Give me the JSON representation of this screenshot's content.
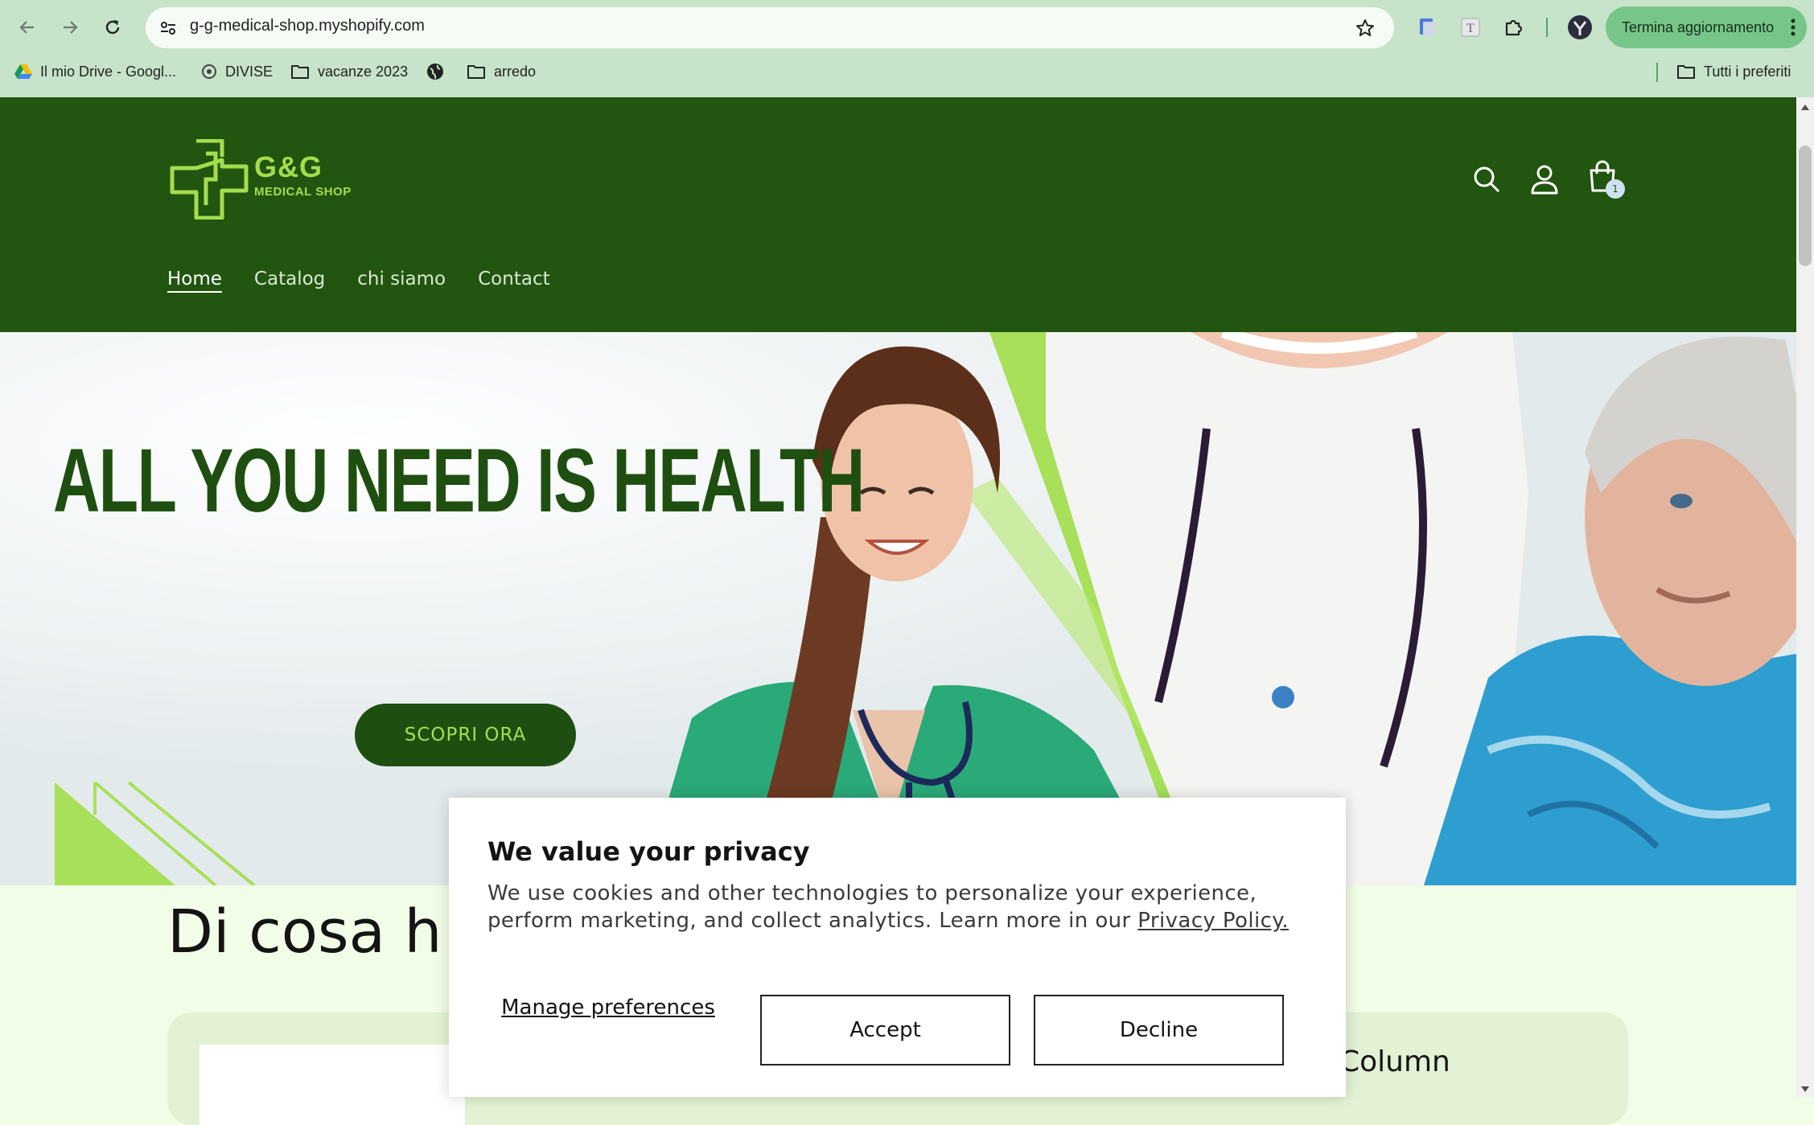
{
  "browser": {
    "url": "g-g-medical-shop.myshopify.com",
    "update_button": "Termina aggiornamento",
    "bookmarks": [
      "Il mio Drive - Googl...",
      "DIVISE",
      "vacanze 2023",
      "arredo"
    ],
    "all_bookmarks": "Tutti i preferiti"
  },
  "header": {
    "logo_title": "G&G",
    "logo_subtitle": "MEDICAL SHOP",
    "cart_count": "1",
    "nav": [
      "Home",
      "Catalog",
      "chi siamo",
      "Contact"
    ]
  },
  "hero": {
    "title": "ALL YOU NEED IS HEALTH",
    "cta": "SCOPRI ORA"
  },
  "section": {
    "title": "Di cosa h",
    "column_label": "Column"
  },
  "cookie": {
    "title": "We value your privacy",
    "text": "We use cookies and other technologies to personalize your experience, perform marketing, and collect analytics. Learn more in our ",
    "policy_link": "Privacy Policy.",
    "manage": "Manage preferences",
    "accept": "Accept",
    "decline": "Decline"
  },
  "colors": {
    "header_bg": "#225510",
    "brand_lime": "#a3dd4f",
    "hero_title": "#1f4f10",
    "chrome_bg": "#c7e3c9"
  }
}
